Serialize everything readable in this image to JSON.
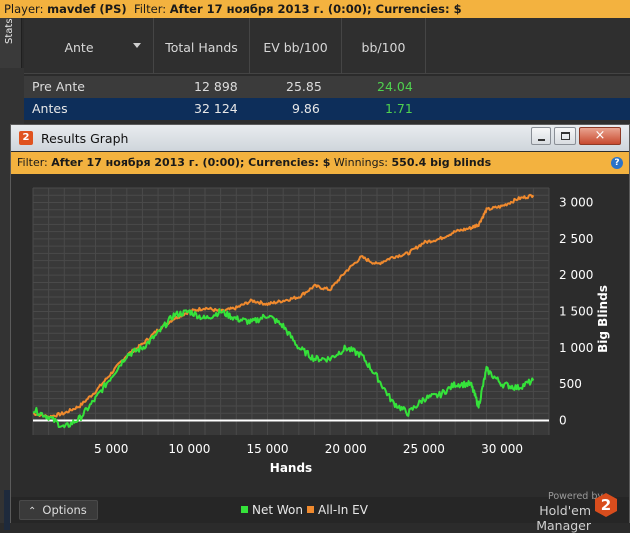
{
  "topbar": {
    "player_label": "Player:",
    "player": "mavdef (PS)",
    "filter_label": "Filter:",
    "filter": "After 17 ноября 2013 г. (0:00); Currencies: $"
  },
  "stats_tab": "Stats",
  "columns": [
    "Ante",
    "Total Hands",
    "EV bb/100",
    "bb/100"
  ],
  "rows": [
    {
      "ante": "Pre Ante",
      "total_hands": "12 898",
      "ev": "25.85",
      "bb": "24.04"
    },
    {
      "ante": "Antes",
      "total_hands": "32 124",
      "ev": "9.86",
      "bb": "1.71"
    },
    {
      "ante": "",
      "total_hands": "",
      "ev": "",
      "bb": ""
    }
  ],
  "window": {
    "title": "Results Graph",
    "logo": "2",
    "close": "×",
    "filter_label": "Filter:",
    "filter": "After 17 ноября 2013 г. (0:00); Currencies: $",
    "winnings_label": "Winnings:",
    "winnings": "550.4 big blinds",
    "help": "?"
  },
  "bottom": {
    "options": "Options",
    "options_arrow": "⌃",
    "powered": "Powered by",
    "brand": "Hold'em Manager",
    "brand_logo": "2"
  },
  "colors": {
    "net_won": "#35e23a",
    "allin_ev": "#f08a2e",
    "zero_line": "#ffffff",
    "accent": "#f3b23f"
  },
  "chart_data": {
    "type": "line",
    "xlabel": "Hands",
    "ylabel": "Big Blinds",
    "xlim": [
      0,
      33000
    ],
    "ylim": [
      -200,
      3200
    ],
    "x_ticks": [
      5000,
      10000,
      15000,
      20000,
      25000,
      30000
    ],
    "x_tick_labels": [
      "5 000",
      "10 000",
      "15 000",
      "20 000",
      "25 000",
      "30 000"
    ],
    "y_ticks": [
      0,
      500,
      1000,
      1500,
      2000,
      2500,
      3000
    ],
    "y_tick_labels": [
      "0",
      "500",
      "1 000",
      "1 500",
      "2 000",
      "2 500",
      "3 000"
    ],
    "legend": [
      "Net Won",
      "All-In EV"
    ],
    "grid": true,
    "series": [
      {
        "name": "Net Won",
        "x": [
          0,
          1000,
          2000,
          3000,
          4000,
          5000,
          6000,
          7000,
          8000,
          9000,
          10000,
          11000,
          12000,
          13000,
          14000,
          15000,
          16000,
          17000,
          18000,
          19000,
          20000,
          21000,
          22000,
          23000,
          24000,
          25000,
          26000,
          27000,
          28000,
          28500,
          29000,
          30000,
          31000,
          32000
        ],
        "y": [
          150,
          50,
          -100,
          30,
          300,
          600,
          900,
          1000,
          1200,
          1450,
          1500,
          1400,
          1500,
          1400,
          1350,
          1450,
          1300,
          1000,
          850,
          850,
          1000,
          900,
          600,
          250,
          100,
          300,
          350,
          500,
          500,
          200,
          700,
          500,
          450,
          550
        ]
      },
      {
        "name": "All-In EV",
        "x": [
          0,
          1000,
          2000,
          3000,
          4000,
          5000,
          6000,
          7000,
          8000,
          9000,
          10000,
          11000,
          12000,
          13000,
          14000,
          15000,
          16000,
          17000,
          18000,
          19000,
          20000,
          21000,
          22000,
          23000,
          24000,
          25000,
          26000,
          27000,
          28000,
          28500,
          29000,
          30000,
          31000,
          32000
        ],
        "y": [
          100,
          50,
          100,
          200,
          400,
          650,
          900,
          1050,
          1250,
          1400,
          1500,
          1550,
          1500,
          1550,
          1650,
          1600,
          1650,
          1700,
          1850,
          1800,
          2050,
          2250,
          2150,
          2250,
          2300,
          2450,
          2500,
          2600,
          2650,
          2700,
          2900,
          2950,
          3050,
          3100
        ]
      }
    ]
  }
}
